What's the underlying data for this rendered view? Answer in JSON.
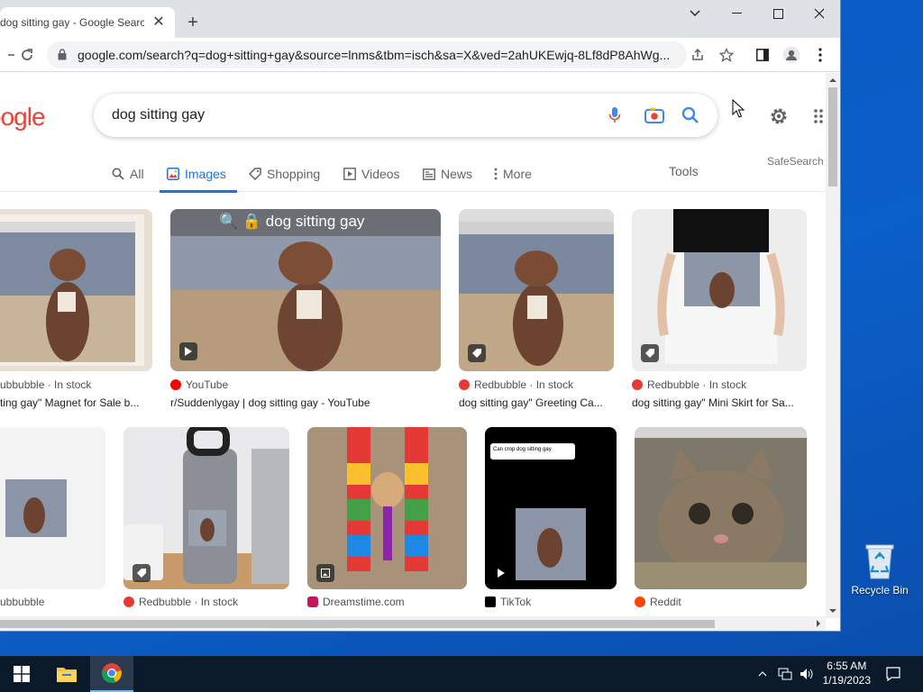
{
  "browser": {
    "tab_title": "dog sitting gay - Google Search",
    "url": "google.com/search?q=dog+sitting+gay&source=lnms&tbm=isch&sa=X&ved=2ahUKEwjq-8Lf8dP8AhWg..."
  },
  "search": {
    "logo_text": "oogle",
    "query": "dog sitting gay",
    "safesearch": "SafeSearch"
  },
  "nav": {
    "all": "All",
    "images": "Images",
    "shopping": "Shopping",
    "videos": "Videos",
    "news": "News",
    "more": "More",
    "tools": "Tools"
  },
  "results": [
    {
      "source": "ubbubble · In stock",
      "caption": "ting gay\" Magnet for Sale b...",
      "fav_color": "#e53935"
    },
    {
      "source": "YouTube",
      "caption": "r/Suddenlygay | dog sitting gay - YouTube",
      "fav_color": "#ff0000"
    },
    {
      "source": "Redbubble · In stock",
      "caption": "dog sitting gay\" Greeting Ca...",
      "fav_color": "#e53935"
    },
    {
      "source": "Redbubble · In stock",
      "caption": "dog sitting gay\" Mini Skirt for Sa...",
      "fav_color": "#e53935"
    },
    {
      "source": "ubbubble",
      "caption": "",
      "fav_color": "#e53935"
    },
    {
      "source": "Redbubble · In stock",
      "caption": "",
      "fav_color": "#e53935"
    },
    {
      "source": "Dreamstime.com",
      "caption": "",
      "fav_color": "#c2185b"
    },
    {
      "source": "TikTok",
      "caption": "",
      "fav_color": "#000000"
    },
    {
      "source": "Reddit",
      "caption": "",
      "fav_color": "#ff4500"
    }
  ],
  "image_overlay": {
    "search_text": "dog sitting gay",
    "tiktok_caption": "Can crop dog sitting gay"
  },
  "desktop": {
    "recycle_bin": "Recycle Bin"
  },
  "taskbar": {
    "time": "6:55 AM",
    "date": "1/19/2023"
  },
  "colors": {
    "google_blue": "#1a73e8",
    "desktop_blue": "#0b5fc8",
    "taskbar": "#0b1a2b"
  }
}
